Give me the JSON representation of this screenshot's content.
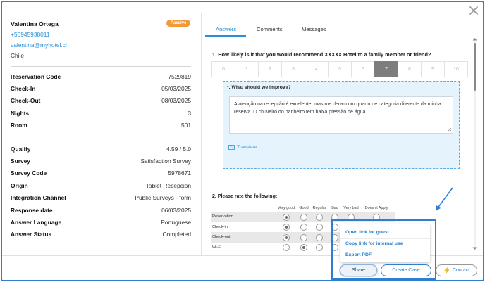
{
  "guest": {
    "name": "Valentina Ortega",
    "status_badge": "Passive",
    "phone": "+56945938011",
    "email": "valentina@myhotel.cl",
    "country": "Chile"
  },
  "reservation": [
    {
      "label": "Reservation Code",
      "value": "7529819"
    },
    {
      "label": "Check-In",
      "value": "05/03/2025"
    },
    {
      "label": "Check-Out",
      "value": "08/03/2025"
    },
    {
      "label": "Nights",
      "value": "3"
    },
    {
      "label": "Room",
      "value": "501"
    }
  ],
  "survey": [
    {
      "label": "Qualify",
      "value": "4.59 / 5.0"
    },
    {
      "label": "Survey",
      "value": "Satisfaction Survey"
    },
    {
      "label": "Survey Code",
      "value": "5978671"
    },
    {
      "label": "Origin",
      "value": "Tablet Recepcion"
    },
    {
      "label": "Integration Channel",
      "value": "Public Surveys - form"
    },
    {
      "label": "Response date",
      "value": "06/03/2025"
    },
    {
      "label": "Answer Language",
      "value": "Portuguese"
    },
    {
      "label": "Answer Status",
      "value": "Completed"
    }
  ],
  "tabs": [
    "Answers",
    "Comments",
    "Messages"
  ],
  "active_tab": "Answers",
  "question1": {
    "text": "1. How likely is it that you would recommend XXXXX Hotel to a family member or friend?",
    "scale": [
      "0",
      "1",
      "2",
      "3",
      "4",
      "5",
      "6",
      "7",
      "8",
      "9",
      "10"
    ],
    "selected": "7"
  },
  "improve": {
    "label": "*. What should we improve?",
    "answer": "A atenção na recepção é excelente, mas me deram um quarto de categoria diferente da minha reserva. O chuveiro do banheiro tem baixa pressão de água",
    "translate_label": "Translate"
  },
  "question2": {
    "text": "2. Please rate the following:",
    "columns": [
      "Very good",
      "Good",
      "Regular",
      "Bad",
      "Very bad",
      "Doesn't Apply"
    ],
    "rows": [
      {
        "label": "Reservation",
        "selected": "Very good"
      },
      {
        "label": "Check-in",
        "selected": "Very good"
      },
      {
        "label": "Check-out",
        "selected": "Very good"
      },
      {
        "label": "Wi-Fi",
        "selected": "Good"
      }
    ]
  },
  "share_menu": {
    "items": [
      "Open link for guest",
      "Copy link for internal use",
      "Export PDF"
    ]
  },
  "buttons": {
    "share": "Share",
    "create_case": "Create Case",
    "contact": "Contact"
  },
  "colors": {
    "accent": "#2a8fd8",
    "badge": "#f29a35",
    "highlight_border": "#2f7fd0",
    "improve_bg": "#e5f3fc"
  }
}
